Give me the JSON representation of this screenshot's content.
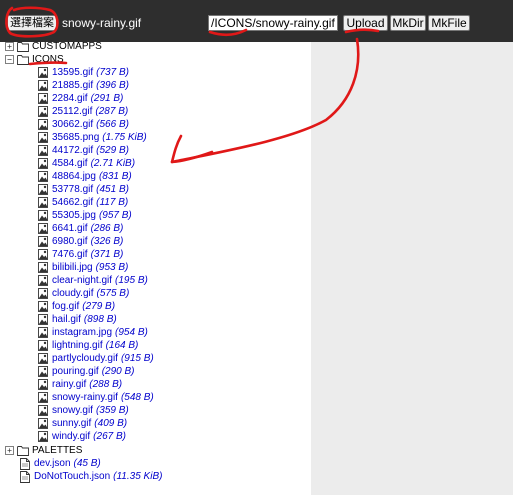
{
  "toolbar": {
    "choose_file_label": "選擇檔案",
    "selected_file": "snowy-rainy.gif",
    "path_value": "/ICONS/snowy-rainy.gif",
    "upload_label": "Upload",
    "mkdir_label": "MkDir",
    "mkfile_label": "MkFile"
  },
  "tree": {
    "folders": [
      {
        "name": "CUSTOMAPPS",
        "state": "collapsed",
        "toggle": "+"
      },
      {
        "name": "ICONS",
        "state": "expanded",
        "toggle": "−"
      },
      {
        "name": "PALETTES",
        "state": "collapsed",
        "toggle": "+"
      }
    ],
    "icons_files": [
      {
        "name": "13595.gif",
        "size": "(737 B)"
      },
      {
        "name": "21885.gif",
        "size": "(396 B)"
      },
      {
        "name": "2284.gif",
        "size": "(291 B)"
      },
      {
        "name": "25112.gif",
        "size": "(287 B)"
      },
      {
        "name": "30662.gif",
        "size": "(566 B)"
      },
      {
        "name": "35685.png",
        "size": "(1.75 KiB)"
      },
      {
        "name": "44172.gif",
        "size": "(529 B)"
      },
      {
        "name": "4584.gif",
        "size": "(2.71 KiB)"
      },
      {
        "name": "48864.jpg",
        "size": "(831 B)"
      },
      {
        "name": "53778.gif",
        "size": "(451 B)"
      },
      {
        "name": "54662.gif",
        "size": "(117 B)"
      },
      {
        "name": "55305.jpg",
        "size": "(957 B)"
      },
      {
        "name": "6641.gif",
        "size": "(286 B)"
      },
      {
        "name": "6980.gif",
        "size": "(326 B)"
      },
      {
        "name": "7476.gif",
        "size": "(371 B)"
      },
      {
        "name": "bilibili.jpg",
        "size": "(953 B)"
      },
      {
        "name": "clear-night.gif",
        "size": "(195 B)"
      },
      {
        "name": "cloudy.gif",
        "size": "(575 B)"
      },
      {
        "name": "fog.gif",
        "size": "(279 B)"
      },
      {
        "name": "hail.gif",
        "size": "(898 B)"
      },
      {
        "name": "instagram.jpg",
        "size": "(954 B)"
      },
      {
        "name": "lightning.gif",
        "size": "(164 B)"
      },
      {
        "name": "partlycloudy.gif",
        "size": "(915 B)"
      },
      {
        "name": "pouring.gif",
        "size": "(290 B)"
      },
      {
        "name": "rainy.gif",
        "size": "(288 B)"
      },
      {
        "name": "snowy-rainy.gif",
        "size": "(548 B)"
      },
      {
        "name": "snowy.gif",
        "size": "(359 B)"
      },
      {
        "name": "sunny.gif",
        "size": "(409 B)"
      },
      {
        "name": "windy.gif",
        "size": "(267 B)"
      }
    ],
    "root_files": [
      {
        "name": "dev.json",
        "size": "(45 B)"
      },
      {
        "name": "DoNotTouch.json",
        "size": "(11.35 KiB)"
      }
    ]
  },
  "colors": {
    "toolbar_bg": "#2e2e2e",
    "link": "#0000cc",
    "annotation": "#e01818",
    "right_panel": "#ececec"
  },
  "icons": {
    "folder": "folder-icon",
    "image_file": "image-file-icon",
    "document_file": "document-file-icon",
    "expand": "plus-icon",
    "collapse": "minus-icon"
  }
}
